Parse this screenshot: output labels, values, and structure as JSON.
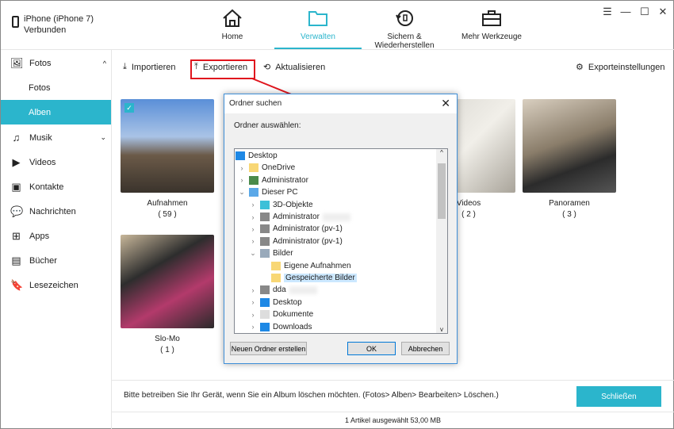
{
  "device": {
    "name": "iPhone (iPhone 7)",
    "status": "Verbunden"
  },
  "tabs": [
    {
      "label": "Home",
      "icon": "home-icon"
    },
    {
      "label": "Verwalten",
      "icon": "folder-icon",
      "active": true
    },
    {
      "label": "Sichern & Wiederherstellen",
      "icon": "backup-restore-icon"
    },
    {
      "label": "Mehr Werkzeuge",
      "icon": "toolbox-icon"
    }
  ],
  "window_controls": [
    "☰",
    "—",
    "☐",
    "✕"
  ],
  "sidebar": {
    "items": [
      {
        "label": "Fotos",
        "icon": "photo-icon"
      },
      {
        "label": "Fotos"
      },
      {
        "label": "Alben",
        "active": true
      },
      {
        "label": "Musik",
        "icon": "music-icon"
      },
      {
        "label": "Videos",
        "icon": "video-icon"
      },
      {
        "label": "Kontakte",
        "icon": "contacts-icon"
      },
      {
        "label": "Nachrichten",
        "icon": "messages-icon"
      },
      {
        "label": "Apps",
        "icon": "apps-icon"
      },
      {
        "label": "Bücher",
        "icon": "books-icon"
      },
      {
        "label": "Lesezeichen",
        "icon": "bookmark-icon"
      }
    ]
  },
  "toolbar": {
    "import": "Importieren",
    "export": "Exportieren",
    "refresh": "Aktualisieren",
    "settings": "Exporteinstellungen"
  },
  "albums": [
    {
      "name": "Aufnahmen",
      "count": "( 59 )",
      "checked": true
    },
    {
      "name": "Videos",
      "count": "( 2 )"
    },
    {
      "name": "Panoramen",
      "count": "( 3 )"
    },
    {
      "name": "Slo-Mo",
      "count": "( 1 )"
    }
  ],
  "bottom": {
    "message": "Bitte betreiben Sie Ihr Gerät, wenn Sie ein Album löschen möchten. (Fotos> Alben> Bearbeiten> Löschen.)",
    "close": "Schließen"
  },
  "status": "1 Artikel ausgewählt 53,00 MB",
  "dialog": {
    "title": "Ordner suchen",
    "label": "Ordner auswählen:",
    "new_folder": "Neuen Ordner erstellen",
    "ok": "OK",
    "cancel": "Abbrechen",
    "tree": [
      {
        "label": "Desktop",
        "level": 0,
        "icon": "desktop-icon"
      },
      {
        "label": "OneDrive",
        "level": 1,
        "icon": "folder-icon",
        "exp": ">"
      },
      {
        "label": "Administrator",
        "level": 1,
        "icon": "user-icon",
        "exp": ">"
      },
      {
        "label": "Dieser PC",
        "level": 1,
        "icon": "computer-icon",
        "exp": "v"
      },
      {
        "label": "3D-Objekte",
        "level": 2,
        "icon": "cube-icon",
        "exp": ">"
      },
      {
        "label": "Administrator",
        "level": 2,
        "icon": "network-drive-icon",
        "exp": ">",
        "blur": true
      },
      {
        "label": "Administrator (pv-1)",
        "level": 2,
        "icon": "network-drive-icon",
        "exp": ">"
      },
      {
        "label": "Administrator (pv-1)",
        "level": 2,
        "icon": "network-drive-icon",
        "exp": ">"
      },
      {
        "label": "Bilder",
        "level": 2,
        "icon": "pictures-icon",
        "exp": "v"
      },
      {
        "label": "Eigene Aufnahmen",
        "level": 3,
        "icon": "folder-icon"
      },
      {
        "label": "Gespeicherte Bilder",
        "level": 3,
        "icon": "folder-icon",
        "selected": true
      },
      {
        "label": "dda",
        "level": 2,
        "icon": "network-drive-icon",
        "exp": ">",
        "blur": true
      },
      {
        "label": "Desktop",
        "level": 2,
        "icon": "desktop-icon",
        "exp": ">"
      },
      {
        "label": "Dokumente",
        "level": 2,
        "icon": "document-icon",
        "exp": ">"
      },
      {
        "label": "Downloads",
        "level": 2,
        "icon": "download-icon",
        "exp": ">"
      }
    ]
  },
  "colors": {
    "accent": "#2bb5cc",
    "highlight": "#e0151d"
  }
}
